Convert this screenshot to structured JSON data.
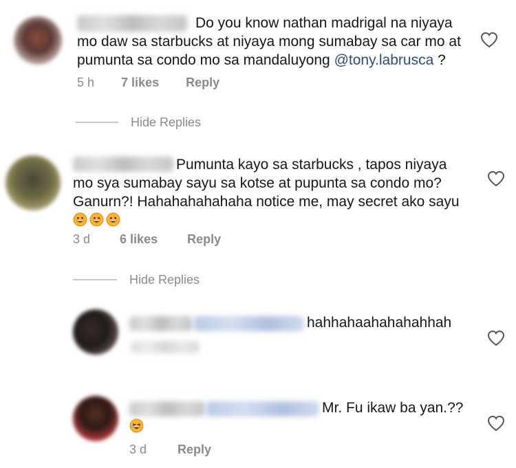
{
  "comments": [
    {
      "text": "Do you know nathan madrigal na niyaya mo daw sa starbucks at niyaya mong sumabay sa car mo at pumunta sa condo mo sa mandaluyong",
      "mention": "@tony.labrusca",
      "text_after": " ?",
      "time": "5 h",
      "likes": "7 likes",
      "reply": "Reply"
    },
    {
      "text": "Pumunta kayo sa starbucks , tapos niyaya mo sya sumabay sayu sa kotse at pupunta sa condo mo? Ganurn?! Hahahahahahaha notice me, may secret ako sayu",
      "emojis": [
        "grinning-face-emoji",
        "grinning-face-emoji",
        "grinning-face-emoji"
      ],
      "time": "3 d",
      "likes": "6 likes",
      "reply": "Reply"
    }
  ],
  "hide_replies": [
    "Hide Replies",
    "Hide Replies"
  ],
  "replies": [
    {
      "text": "hahhahaahahahahhah"
    },
    {
      "text": "Mr. Fu ikaw ba yan.??",
      "emojis": [
        "laughing-face-emoji"
      ],
      "time": "3 d",
      "reply": "Reply"
    }
  ],
  "icons": {
    "like": "heart-outline-icon"
  },
  "colors": {
    "mention": "#2b4f7a",
    "meta": "#8a8a8a",
    "divider": "#c8c8c8"
  }
}
